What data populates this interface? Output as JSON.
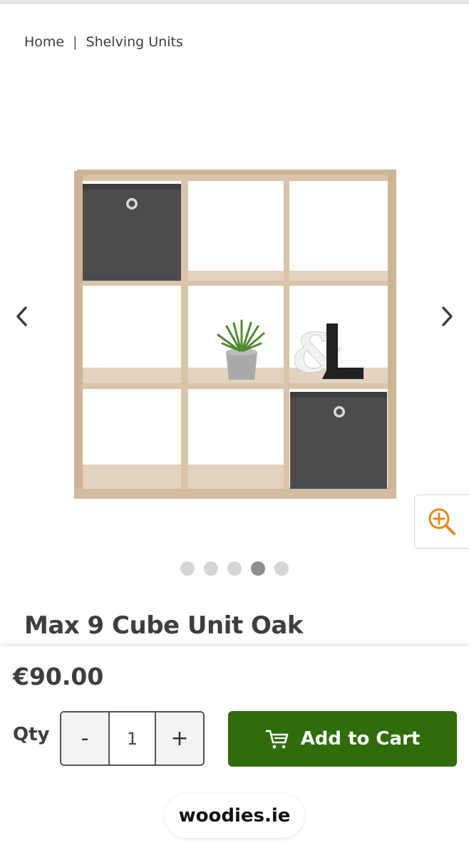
{
  "breadcrumb": {
    "items": [
      "Home",
      "Shelving Units"
    ],
    "separator": "|"
  },
  "gallery": {
    "total_images": 5,
    "active_index": 3
  },
  "product": {
    "title": "Max 9 Cube Unit Oak",
    "price": "€90.00"
  },
  "purchase": {
    "qty_label": "Qty",
    "quantity": "1",
    "minus": "-",
    "plus": "+",
    "add_to_cart": "Add to Cart"
  },
  "browser": {
    "url": "woodies.ie"
  },
  "colors": {
    "brand_green": "#2f6d0b",
    "zoom_accent": "#e08a1a"
  },
  "icons": [
    "chevron-left-icon",
    "chevron-right-icon",
    "zoom-in-icon",
    "cart-icon"
  ]
}
